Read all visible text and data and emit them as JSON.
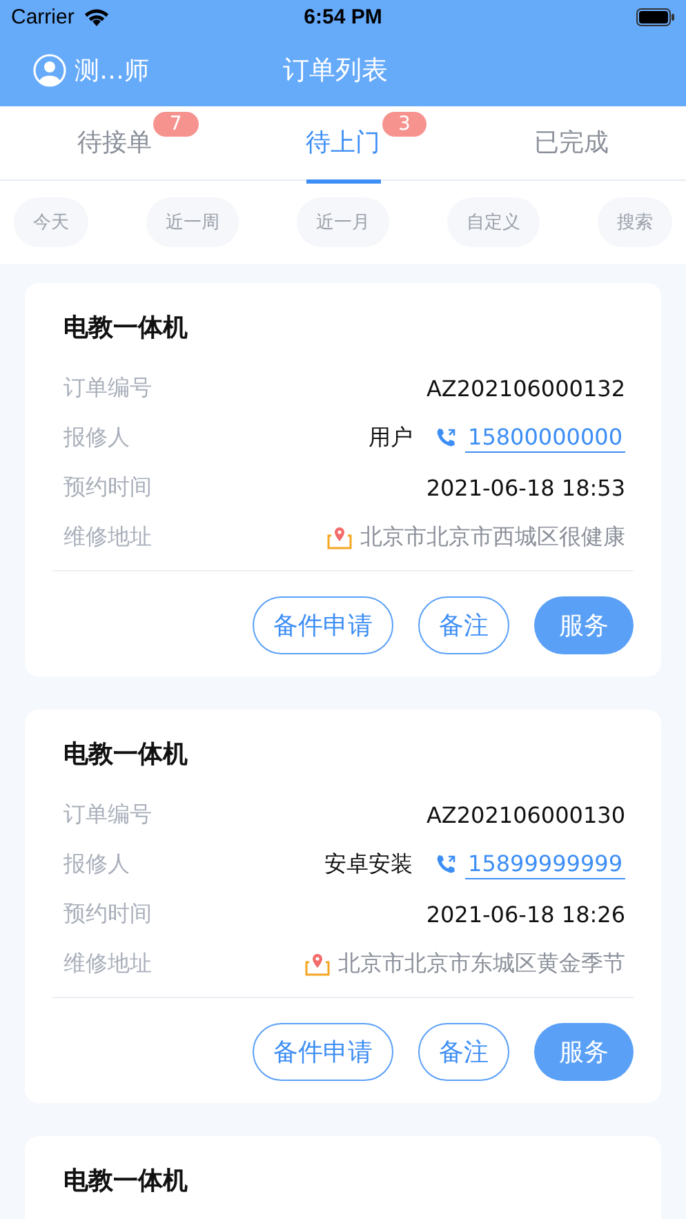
{
  "status_bar": {
    "carrier": "Carrier",
    "time": "6:54 PM"
  },
  "nav": {
    "user": "测…师",
    "title": "订单列表"
  },
  "tabs": [
    {
      "label": "待接单",
      "badge": "7",
      "selected": false
    },
    {
      "label": "待上门",
      "badge": "3",
      "selected": true
    },
    {
      "label": "已完成",
      "selected": false
    }
  ],
  "filters": [
    "今天",
    "近一周",
    "近一月",
    "自定义",
    "搜索"
  ],
  "orders": [
    {
      "title": "电教一体机",
      "fields": [
        {
          "label": "订单编号",
          "value": "AZ202106000132"
        },
        {
          "label": "报修人",
          "value": "用户",
          "phone": "15800000000"
        },
        {
          "label": "预约时间",
          "value": "2021-06-18 18:53"
        },
        {
          "label": "维修地址",
          "address": "北京市北京市西城区很健康"
        }
      ],
      "buttons": [
        {
          "label": "备件申请",
          "kind": "outline"
        },
        {
          "label": "备注",
          "kind": "outline"
        },
        {
          "label": "服务",
          "kind": "primary"
        }
      ]
    },
    {
      "title": "电教一体机",
      "fields": [
        {
          "label": "订单编号",
          "value": "AZ202106000130"
        },
        {
          "label": "报修人",
          "value": "安卓安装",
          "phone": "15899999999"
        },
        {
          "label": "预约时间",
          "value": "2021-06-18 18:26"
        },
        {
          "label": "维修地址",
          "address": "北京市北京市东城区黄金季节"
        }
      ],
      "buttons": [
        {
          "label": "备件申请",
          "kind": "outline"
        },
        {
          "label": "备注",
          "kind": "outline"
        },
        {
          "label": "服务",
          "kind": "primary"
        }
      ]
    },
    {
      "title": "电教一体机"
    }
  ]
}
